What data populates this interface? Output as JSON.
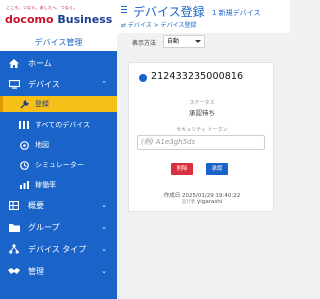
{
  "brand": {
    "tagline": "こころ、つなぐ。あしたへ、つなぐ。",
    "name_part1": "docomo",
    "name_part2": "Business",
    "section_label": "デバイス管理"
  },
  "sidebar": {
    "items": [
      {
        "label": "ホーム",
        "icon": "home-icon"
      },
      {
        "label": "デバイス",
        "icon": "monitor-icon",
        "chevron": "⌃"
      },
      {
        "label": "概要",
        "icon": "grid-icon",
        "chevron": "⌄"
      },
      {
        "label": "グループ",
        "icon": "folder-icon",
        "chevron": "⌄"
      },
      {
        "label": "デバイス タイプ",
        "icon": "network-icon",
        "chevron": "⌄"
      },
      {
        "label": "管理",
        "icon": "handshake-icon",
        "chevron": "⌄"
      }
    ],
    "device_subitems": [
      {
        "label": "登録",
        "icon": "wrench-icon",
        "active": true
      },
      {
        "label": "すべてのデバイス",
        "icon": "list-icon"
      },
      {
        "label": "地図",
        "icon": "map-pin-icon"
      },
      {
        "label": "シミュレーター",
        "icon": "simulator-icon"
      },
      {
        "label": "稼働率",
        "icon": "bar-chart-icon"
      }
    ]
  },
  "header": {
    "title": "デバイス登録",
    "subtitle": "1 新規デバイス",
    "breadcrumb": "⇄ デバイス > デバイス登録"
  },
  "toolbar": {
    "display_label": "表示方法",
    "display_value": "自動"
  },
  "card": {
    "device_id": "212433235000816",
    "status_label": "ステータス",
    "status_value": "承認待ち",
    "token_label": "セキュリティ トークン",
    "token_placeholder": "(例) A1e3gh5ds",
    "delete_label": "削除",
    "approve_label": "承認",
    "created_label": "作成日",
    "created_value": "2025/01/29 19:40:22",
    "actor_label": "実行者",
    "actor_value": "yigarashi"
  },
  "colors": {
    "primary": "#1a63c9",
    "active": "#f6c018",
    "danger": "#d8303f"
  }
}
